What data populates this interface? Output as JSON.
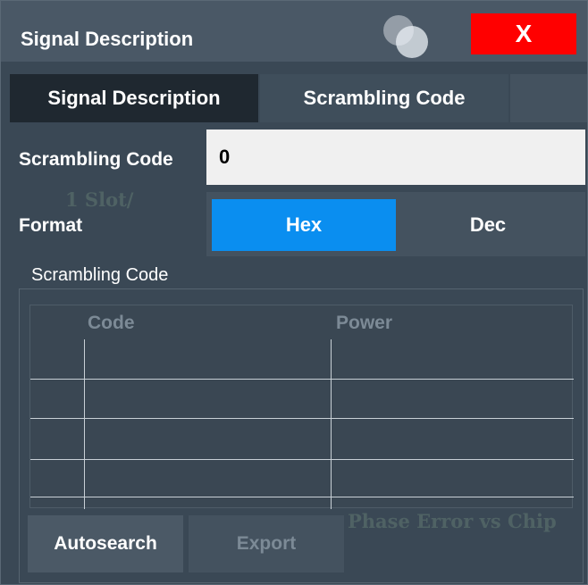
{
  "window": {
    "title": "Signal Description",
    "close_label": "X"
  },
  "tabs": [
    {
      "label": "Signal Description",
      "active": false
    },
    {
      "label": "Scrambling Code",
      "active": true
    }
  ],
  "scrambling_code": {
    "label": "Scrambling Code",
    "value": "0"
  },
  "format": {
    "label": "Format",
    "options": [
      "Hex",
      "Dec"
    ],
    "selected": "Hex"
  },
  "table_section": {
    "title": "Scrambling Code",
    "columns": [
      "Code",
      "Power"
    ],
    "rows": []
  },
  "buttons": {
    "autosearch": "Autosearch",
    "export": "Export"
  },
  "colors": {
    "close": "#ff0000",
    "selected_toggle": "#0a8ef0"
  }
}
